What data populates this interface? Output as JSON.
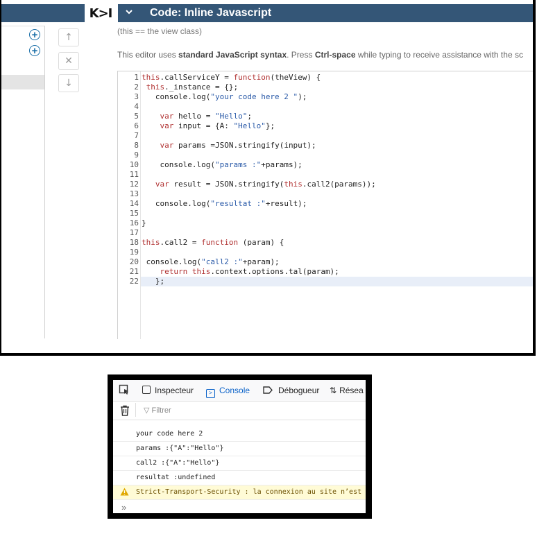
{
  "editor_panel": {
    "logo": "K>I",
    "title": "Code: Inline Javascript",
    "subtitle": "(this == the view class)",
    "info_prefix": "This editor uses ",
    "info_syntax": "standard JavaScript syntax",
    "info_mid": ". Press ",
    "info_key": "Ctrl-space",
    "info_suffix": " while typing to receive assistance with the sc",
    "icons": {
      "add": "plus-circle-icon",
      "up": "arrow-up-icon",
      "delete": "close-icon",
      "down": "arrow-down-icon"
    },
    "line_numbers": [
      "1",
      "2",
      "3",
      "4",
      "5",
      "6",
      "7",
      "8",
      "9",
      "10",
      "11",
      "12",
      "13",
      "14",
      "15",
      "16",
      "17",
      "18",
      "19",
      "20",
      "21",
      "22"
    ],
    "code_lines": [
      "this.callServiceY = function(theView) {",
      " this._instance = {};",
      "   console.log(\"your code here 2 \");",
      "",
      "    var hello = \"Hello\";",
      "    var input = {A: \"Hello\"};",
      "",
      "    var params =JSON.stringify(input);",
      "",
      "    console.log(\"params :\"+params);",
      "",
      "   var result = JSON.stringify(this.call2(params));",
      "",
      "   console.log(\"resultat :\"+result);",
      "",
      "}",
      "",
      "this.call2 = function (param) {",
      "",
      " console.log(\"call2 :\"+param);",
      "    return this.context.options.tal(param);",
      "   };"
    ]
  },
  "devtools": {
    "tabs": [
      "Inspecteur",
      "Console",
      "Débogueur",
      "Résea"
    ],
    "active_tab": "Console",
    "filter_placeholder": "Filtrer",
    "messages": [
      "your code here 2",
      "params :{\"A\":\"Hello\"}",
      "call2 :{\"A\":\"Hello\"}",
      "resultat :undefined"
    ],
    "warning": "Strict-Transport-Security : la connexion au site n’est",
    "prompt": "»"
  },
  "colors": {
    "titlebar": "#345677",
    "accent_blue": "#0a62c9",
    "keyword": "#b03030",
    "string": "#2a5aa8",
    "warning_bg": "#fffbd6"
  }
}
